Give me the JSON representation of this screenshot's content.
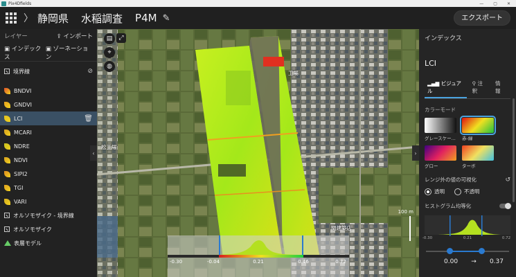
{
  "window": {
    "title": "Pix4Dfields"
  },
  "header": {
    "crumbs": [
      "静岡県",
      "水稲調査",
      "P4M"
    ],
    "export_label": "エクスポート"
  },
  "left": {
    "layers_label": "レイヤー",
    "import_label": "インポート",
    "index_label": "インデックス",
    "zonation_label": "ゾーネーション",
    "boundary_label": "境界線",
    "items": [
      {
        "label": "BNDVI",
        "color": "#e0502a"
      },
      {
        "label": "GNDVI",
        "color": "#e8a020"
      },
      {
        "label": "LCI",
        "color": "#e0c020"
      },
      {
        "label": "MCARI",
        "color": "#d8a020"
      },
      {
        "label": "NDRE",
        "color": "#c8c020"
      },
      {
        "label": "NDVI",
        "color": "#d8a020"
      },
      {
        "label": "SIPI2",
        "color": "#e08a20"
      },
      {
        "label": "TGI",
        "color": "#e0a020"
      },
      {
        "label": "VARI",
        "color": "#d8b020"
      }
    ],
    "other_items": [
      {
        "label": "オルソモザイク - 境界線"
      },
      {
        "label": "オルソモザイク"
      },
      {
        "label": "表層モデル"
      }
    ]
  },
  "map": {
    "labels": [
      "工場",
      "松工場",
      "関建築店"
    ],
    "scale_label": "100 m",
    "hist_ticks": [
      "-0.30",
      "-0.04",
      "0.21",
      "0.46",
      "0.72"
    ]
  },
  "right": {
    "title": "インデックス",
    "index_name": "LCI",
    "tabs": [
      "ビジュアル",
      "注釈",
      "情報"
    ],
    "color_mode_label": "カラーモード",
    "swatches": [
      "グレースケー...",
      "赤-緑",
      "グロー",
      "ターボ"
    ],
    "range_label": "レンジ外の値の可視化",
    "radio_transparent": "透明",
    "radio_opaque": "不透明",
    "hist_eq_label": "ヒストグラム均等化",
    "hist_ticks": [
      "-0.30",
      "0.21",
      "0.72"
    ],
    "value_low": "0.00",
    "value_high": "0.37"
  }
}
